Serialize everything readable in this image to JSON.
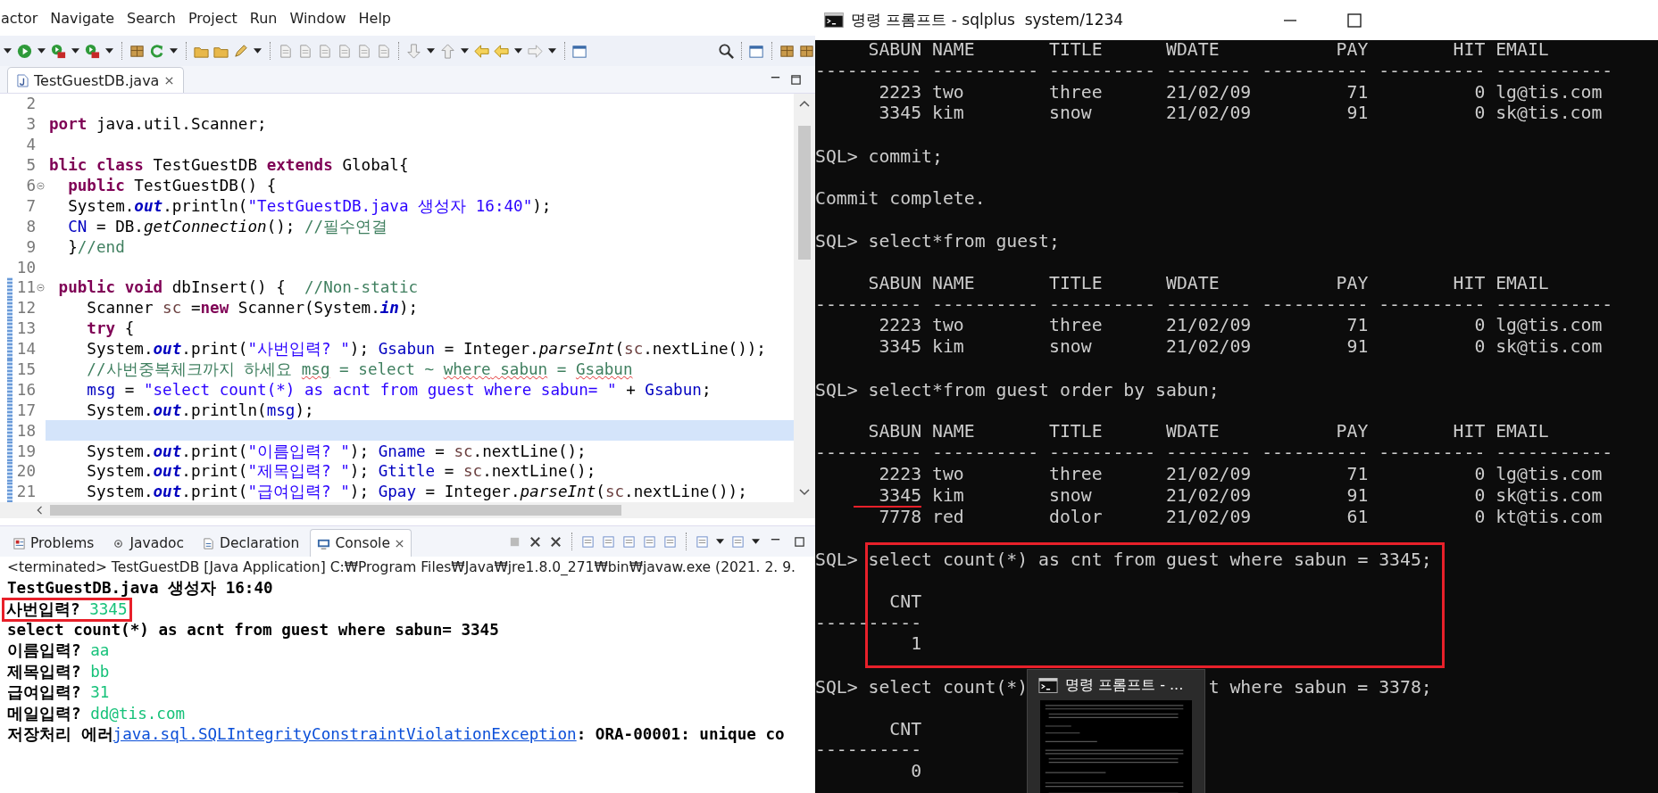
{
  "eclipse": {
    "menu": [
      "actor",
      "Navigate",
      "Search",
      "Project",
      "Run",
      "Window",
      "Help"
    ],
    "editor": {
      "tab": {
        "label": "TestGuestDB.java",
        "selected": true
      },
      "lines": [
        {
          "number": "2",
          "fold": false,
          "changed": false,
          "current": false
        },
        {
          "number": "3",
          "fold": false,
          "changed": false,
          "current": false,
          "segments": [
            {
              "kind": "kw",
              "text": "port"
            },
            {
              "kind": "plain",
              "text": " java.util.Scanner;"
            }
          ]
        },
        {
          "number": "4",
          "fold": false,
          "changed": false,
          "current": false
        },
        {
          "number": "5",
          "fold": false,
          "changed": false,
          "current": false,
          "segments": [
            {
              "kind": "kw",
              "text": "blic class"
            },
            {
              "kind": "plain",
              "text": " TestGuestDB "
            },
            {
              "kind": "kw",
              "text": "extends"
            },
            {
              "kind": "plain",
              "text": " Global{"
            }
          ]
        },
        {
          "number": "6",
          "fold": true,
          "changed": false,
          "current": false,
          "segments": [
            {
              "kind": "kw",
              "text": "  public"
            },
            {
              "kind": "plain",
              "text": " TestGuestDB() {"
            }
          ]
        },
        {
          "number": "7",
          "fold": false,
          "changed": false,
          "current": false,
          "segments": [
            {
              "kind": "plain",
              "text": "  System."
            },
            {
              "kind": "sfield",
              "text": "out"
            },
            {
              "kind": "plain",
              "text": ".println("
            },
            {
              "kind": "str",
              "text": "\"TestGuestDB.java 생성자 16:40\""
            },
            {
              "kind": "plain",
              "text": ");"
            }
          ]
        },
        {
          "number": "8",
          "fold": false,
          "changed": false,
          "current": false,
          "segments": [
            {
              "kind": "field",
              "text": "  CN"
            },
            {
              "kind": "plain",
              "text": " = DB."
            },
            {
              "kind": "smethod",
              "text": "getConnection"
            },
            {
              "kind": "plain",
              "text": "(); "
            },
            {
              "kind": "cmt",
              "text": "//필수연결"
            }
          ]
        },
        {
          "number": "9",
          "fold": false,
          "changed": false,
          "current": false,
          "segments": [
            {
              "kind": "plain",
              "text": "  }"
            },
            {
              "kind": "cmt",
              "text": "//end"
            }
          ]
        },
        {
          "number": "10",
          "fold": false,
          "changed": false,
          "current": false
        },
        {
          "number": "11",
          "fold": true,
          "changed": true,
          "current": false,
          "segments": [
            {
              "kind": "kw",
              "text": " public void"
            },
            {
              "kind": "plain",
              "text": " dbInsert() {  "
            },
            {
              "kind": "cmt",
              "text": "//Non-static"
            }
          ]
        },
        {
          "number": "12",
          "fold": false,
          "changed": true,
          "current": false,
          "segments": [
            {
              "kind": "plain",
              "text": "    Scanner "
            },
            {
              "kind": "local",
              "text": "sc"
            },
            {
              "kind": "plain",
              "text": " ="
            },
            {
              "kind": "kw",
              "text": "new"
            },
            {
              "kind": "plain",
              "text": " Scanner(System."
            },
            {
              "kind": "sfield",
              "text": "in"
            },
            {
              "kind": "plain",
              "text": ");"
            }
          ]
        },
        {
          "number": "13",
          "fold": false,
          "changed": true,
          "current": false,
          "segments": [
            {
              "kind": "kw",
              "text": "    try"
            },
            {
              "kind": "plain",
              "text": " {"
            }
          ]
        },
        {
          "number": "14",
          "fold": false,
          "changed": true,
          "current": false,
          "segments": [
            {
              "kind": "plain",
              "text": "    System."
            },
            {
              "kind": "sfield",
              "text": "out"
            },
            {
              "kind": "plain",
              "text": ".print("
            },
            {
              "kind": "str",
              "text": "\"사번입력? \""
            },
            {
              "kind": "plain",
              "text": "); "
            },
            {
              "kind": "field",
              "text": "Gsabun"
            },
            {
              "kind": "plain",
              "text": " = Integer."
            },
            {
              "kind": "smethod",
              "text": "parseInt"
            },
            {
              "kind": "plain",
              "text": "("
            },
            {
              "kind": "local",
              "text": "sc"
            },
            {
              "kind": "plain",
              "text": ".nextLine());"
            }
          ]
        },
        {
          "number": "15",
          "fold": false,
          "changed": true,
          "current": false,
          "segments": [
            {
              "kind": "cmt",
              "text": "    //사번중복체크까지 하세요 "
            },
            {
              "kind": "flagged",
              "text": "msg"
            },
            {
              "kind": "cmt",
              "text": " = select ~ "
            },
            {
              "kind": "flagged",
              "text": "where"
            },
            {
              "kind": "flagged",
              "text": " sabun"
            },
            {
              "kind": "cmt",
              "text": " = "
            },
            {
              "kind": "flagged",
              "text": "Gsabun"
            }
          ]
        },
        {
          "number": "16",
          "fold": false,
          "changed": true,
          "current": false,
          "segments": [
            {
              "kind": "field",
              "text": "    msg"
            },
            {
              "kind": "plain",
              "text": " = "
            },
            {
              "kind": "str",
              "text": "\"select count(*) as acnt from guest where sabun= \""
            },
            {
              "kind": "plain",
              "text": " + "
            },
            {
              "kind": "field",
              "text": "Gsabun"
            },
            {
              "kind": "plain",
              "text": ";"
            }
          ]
        },
        {
          "number": "17",
          "fold": false,
          "changed": true,
          "current": false,
          "segments": [
            {
              "kind": "plain",
              "text": "    System."
            },
            {
              "kind": "sfield",
              "text": "out"
            },
            {
              "kind": "plain",
              "text": ".println("
            },
            {
              "kind": "field",
              "text": "msg"
            },
            {
              "kind": "plain",
              "text": ");"
            }
          ]
        },
        {
          "number": "18",
          "fold": false,
          "changed": true,
          "current": true
        },
        {
          "number": "19",
          "fold": false,
          "changed": true,
          "current": false,
          "segments": [
            {
              "kind": "plain",
              "text": "    System."
            },
            {
              "kind": "sfield",
              "text": "out"
            },
            {
              "kind": "plain",
              "text": ".print("
            },
            {
              "kind": "str",
              "text": "\"이름입력? \""
            },
            {
              "kind": "plain",
              "text": "); "
            },
            {
              "kind": "field",
              "text": "Gname"
            },
            {
              "kind": "plain",
              "text": " = "
            },
            {
              "kind": "local",
              "text": "sc"
            },
            {
              "kind": "plain",
              "text": ".nextLine();"
            }
          ]
        },
        {
          "number": "20",
          "fold": false,
          "changed": true,
          "current": false,
          "segments": [
            {
              "kind": "plain",
              "text": "    System."
            },
            {
              "kind": "sfield",
              "text": "out"
            },
            {
              "kind": "plain",
              "text": ".print("
            },
            {
              "kind": "str",
              "text": "\"제목입력? \""
            },
            {
              "kind": "plain",
              "text": "); "
            },
            {
              "kind": "field",
              "text": "Gtitle"
            },
            {
              "kind": "plain",
              "text": " = "
            },
            {
              "kind": "local",
              "text": "sc"
            },
            {
              "kind": "plain",
              "text": ".nextLine();"
            }
          ]
        },
        {
          "number": "21",
          "fold": false,
          "changed": true,
          "current": false,
          "segments": [
            {
              "kind": "plain",
              "text": "    System."
            },
            {
              "kind": "sfield",
              "text": "out"
            },
            {
              "kind": "plain",
              "text": ".print("
            },
            {
              "kind": "str",
              "text": "\"급여입력? \""
            },
            {
              "kind": "plain",
              "text": "); "
            },
            {
              "kind": "field",
              "text": "Gpay"
            },
            {
              "kind": "plain",
              "text": " = Integer."
            },
            {
              "kind": "smethod",
              "text": "parseInt"
            },
            {
              "kind": "plain",
              "text": "("
            },
            {
              "kind": "local",
              "text": "sc"
            },
            {
              "kind": "plain",
              "text": ".nextLine());"
            }
          ]
        }
      ]
    },
    "views": {
      "tabs": [
        {
          "label": "Problems",
          "selected": false
        },
        {
          "label": "Javadoc",
          "selected": false
        },
        {
          "label": "Declaration",
          "selected": false
        },
        {
          "label": "Console",
          "selected": true
        }
      ],
      "console": {
        "header": "<terminated> TestGuestDB [Java Application] C:₩Program Files₩Java₩jre1.8.0_271₩bin₩javaw.exe (2021. 2. 9.",
        "lines": [
          {
            "highlighted": false,
            "segments": [
              {
                "kind": "out",
                "text": "TestGuestDB.java 생성자 16:40"
              }
            ]
          },
          {
            "highlighted": true,
            "segments": [
              {
                "kind": "out",
                "text": "사번입력? "
              },
              {
                "kind": "input",
                "text": "3345"
              }
            ]
          },
          {
            "highlighted": false,
            "segments": [
              {
                "kind": "out",
                "text": "select count(*) as acnt from guest where sabun= 3345"
              }
            ]
          },
          {
            "highlighted": false,
            "segments": [
              {
                "kind": "out",
                "text": "이름입력? "
              },
              {
                "kind": "input",
                "text": "aa"
              }
            ]
          },
          {
            "highlighted": false,
            "segments": [
              {
                "kind": "out",
                "text": "제목입력? "
              },
              {
                "kind": "input",
                "text": "bb"
              }
            ]
          },
          {
            "highlighted": false,
            "segments": [
              {
                "kind": "out",
                "text": "급여입력? "
              },
              {
                "kind": "input",
                "text": "31"
              }
            ]
          },
          {
            "highlighted": false,
            "segments": [
              {
                "kind": "out",
                "text": "메일입력? "
              },
              {
                "kind": "input",
                "text": "dd@tis.com"
              }
            ]
          },
          {
            "highlighted": false,
            "segments": [
              {
                "kind": "out",
                "text": "저장처리 에러"
              },
              {
                "kind": "link",
                "text": "java.sql.SQLIntegrityConstraintViolationException"
              },
              {
                "kind": "out",
                "text": ": ORA-00001: unique co"
              }
            ]
          }
        ]
      }
    }
  },
  "terminal": {
    "title": "명령 프롬프트 - sqlplus  system/1234",
    "entries": [
      {
        "highlighted": false,
        "output": [
          {
            "text": "     SABUN NAME       TITLE      WDATE           PAY        HIT EMAIL",
            "underlined": false
          },
          {
            "text": "---------- ---------- ---------- -------- ---------- ---------- -----------",
            "underlined": false
          },
          {
            "text": "      2223 two        three      21/02/09         71          0 lg@tis.com",
            "underlined": false
          },
          {
            "text": "      3345 kim        snow       21/02/09         91          0 sk@tis.com",
            "underlined": false
          }
        ]
      },
      {
        "highlighted": false,
        "command": [
          "SQL> commit;"
        ],
        "output": [
          {
            "text": "Commit complete.",
            "underlined": false
          }
        ]
      },
      {
        "highlighted": false,
        "command": [
          "SQL> select*from guest;"
        ],
        "output": [
          {
            "text": "     SABUN NAME       TITLE      WDATE           PAY        HIT EMAIL",
            "underlined": false
          },
          {
            "text": "---------- ---------- ---------- -------- ---------- ---------- -----------",
            "underlined": false
          },
          {
            "text": "      2223 two        three      21/02/09         71          0 lg@tis.com",
            "underlined": false
          },
          {
            "text": "      3345 kim        snow       21/02/09         91          0 sk@tis.com",
            "underlined": false
          }
        ]
      },
      {
        "highlighted": false,
        "command": [
          "SQL> select*from guest order by sabun;"
        ],
        "output": [
          {
            "text": "     SABUN NAME       TITLE      WDATE           PAY        HIT EMAIL",
            "underlined": false
          },
          {
            "text": "---------- ---------- ---------- -------- ---------- ---------- -----------",
            "underlined": false
          },
          {
            "text": "      2223 two        three      21/02/09         71          0 lg@tis.com",
            "underlined": false
          },
          {
            "text": "      3345 kim        snow       21/02/09         91          0 sk@tis.com",
            "underlined": true
          },
          {
            "text": "      7778 red        dolor      21/02/09         61          0 kt@tis.com",
            "underlined": false
          }
        ]
      },
      {
        "highlighted": true,
        "command": [
          "SQL> select count(*) as cnt from guest where sabun = 3345;"
        ],
        "output": [
          {
            "text": "       CNT",
            "underlined": false
          },
          {
            "text": "----------",
            "underlined": false
          },
          {
            "text": "         1",
            "underlined": false
          }
        ]
      },
      {
        "highlighted": false,
        "command": [
          "SQL> select count(*)",
          "t where sabun = 3378;"
        ],
        "output": [
          {
            "text": "       CNT",
            "underlined": false
          },
          {
            "text": "----------",
            "underlined": false
          },
          {
            "text": "         0",
            "underlined": false
          }
        ]
      }
    ],
    "preview": {
      "title": "명령 프롬프트 - ..."
    }
  }
}
